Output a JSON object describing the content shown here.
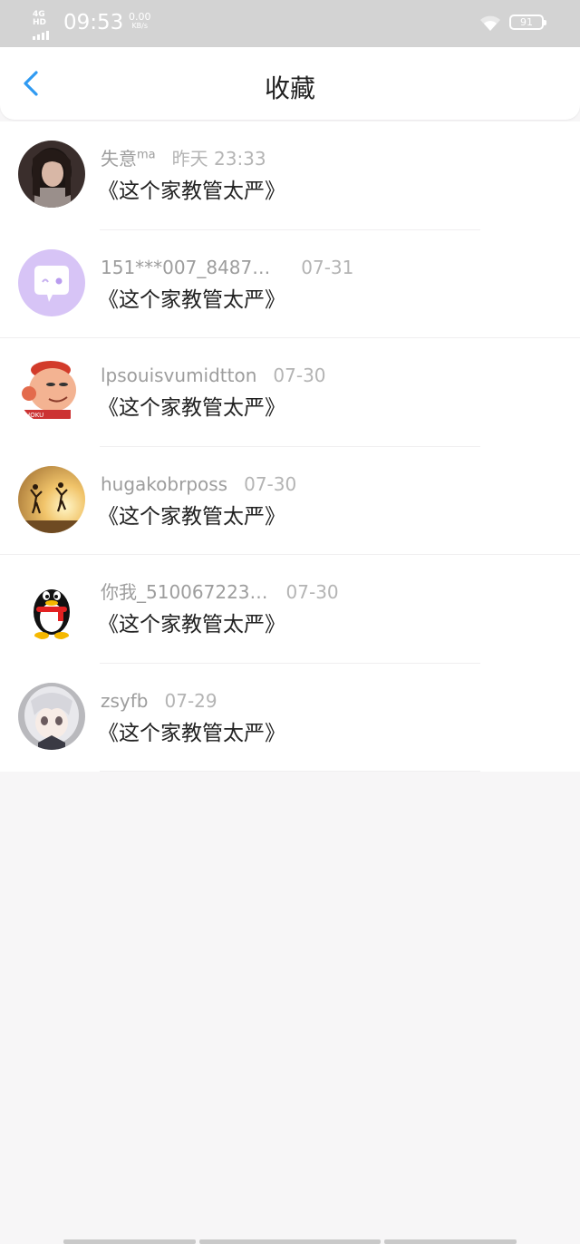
{
  "status_bar": {
    "network": "4G HD",
    "time": "09:53",
    "speed_value": "0.00",
    "speed_unit": "KB/s",
    "battery": "91"
  },
  "header": {
    "title": "收藏",
    "back_icon": "chevron-left-icon"
  },
  "colors": {
    "accent": "#2f9af2",
    "status_bar_bg": "#d3d3d3",
    "page_bg": "#f7f6f7",
    "title_text": "#222222",
    "meta_text": "#9d9d9d"
  },
  "favorites": [
    {
      "user": "失意",
      "user_suffix": "ma",
      "date": "昨天 23:33",
      "title": "《这个家教管太严》",
      "avatar": "photo-girl"
    },
    {
      "user": "151***007_8487…",
      "user_suffix": "",
      "date": "07-31",
      "title": "《这个家教管太严》",
      "avatar": "chat-bubble"
    },
    {
      "user": "lpsouisvumidtton",
      "user_suffix": "",
      "date": "07-30",
      "title": "《这个家教管太严》",
      "avatar": "cartoon-red-hair"
    },
    {
      "user": "hugakobrposs",
      "user_suffix": "",
      "date": "07-30",
      "title": "《这个家教管太严》",
      "avatar": "sunset-jump"
    },
    {
      "user": "你我_510067223…",
      "user_suffix": "",
      "date": "07-30",
      "title": "《这个家教管太严》",
      "avatar": "qq-penguin"
    },
    {
      "user": "zsyfb",
      "user_suffix": "",
      "date": "07-29",
      "title": "《这个家教管太严》",
      "avatar": "anime-girl"
    }
  ]
}
